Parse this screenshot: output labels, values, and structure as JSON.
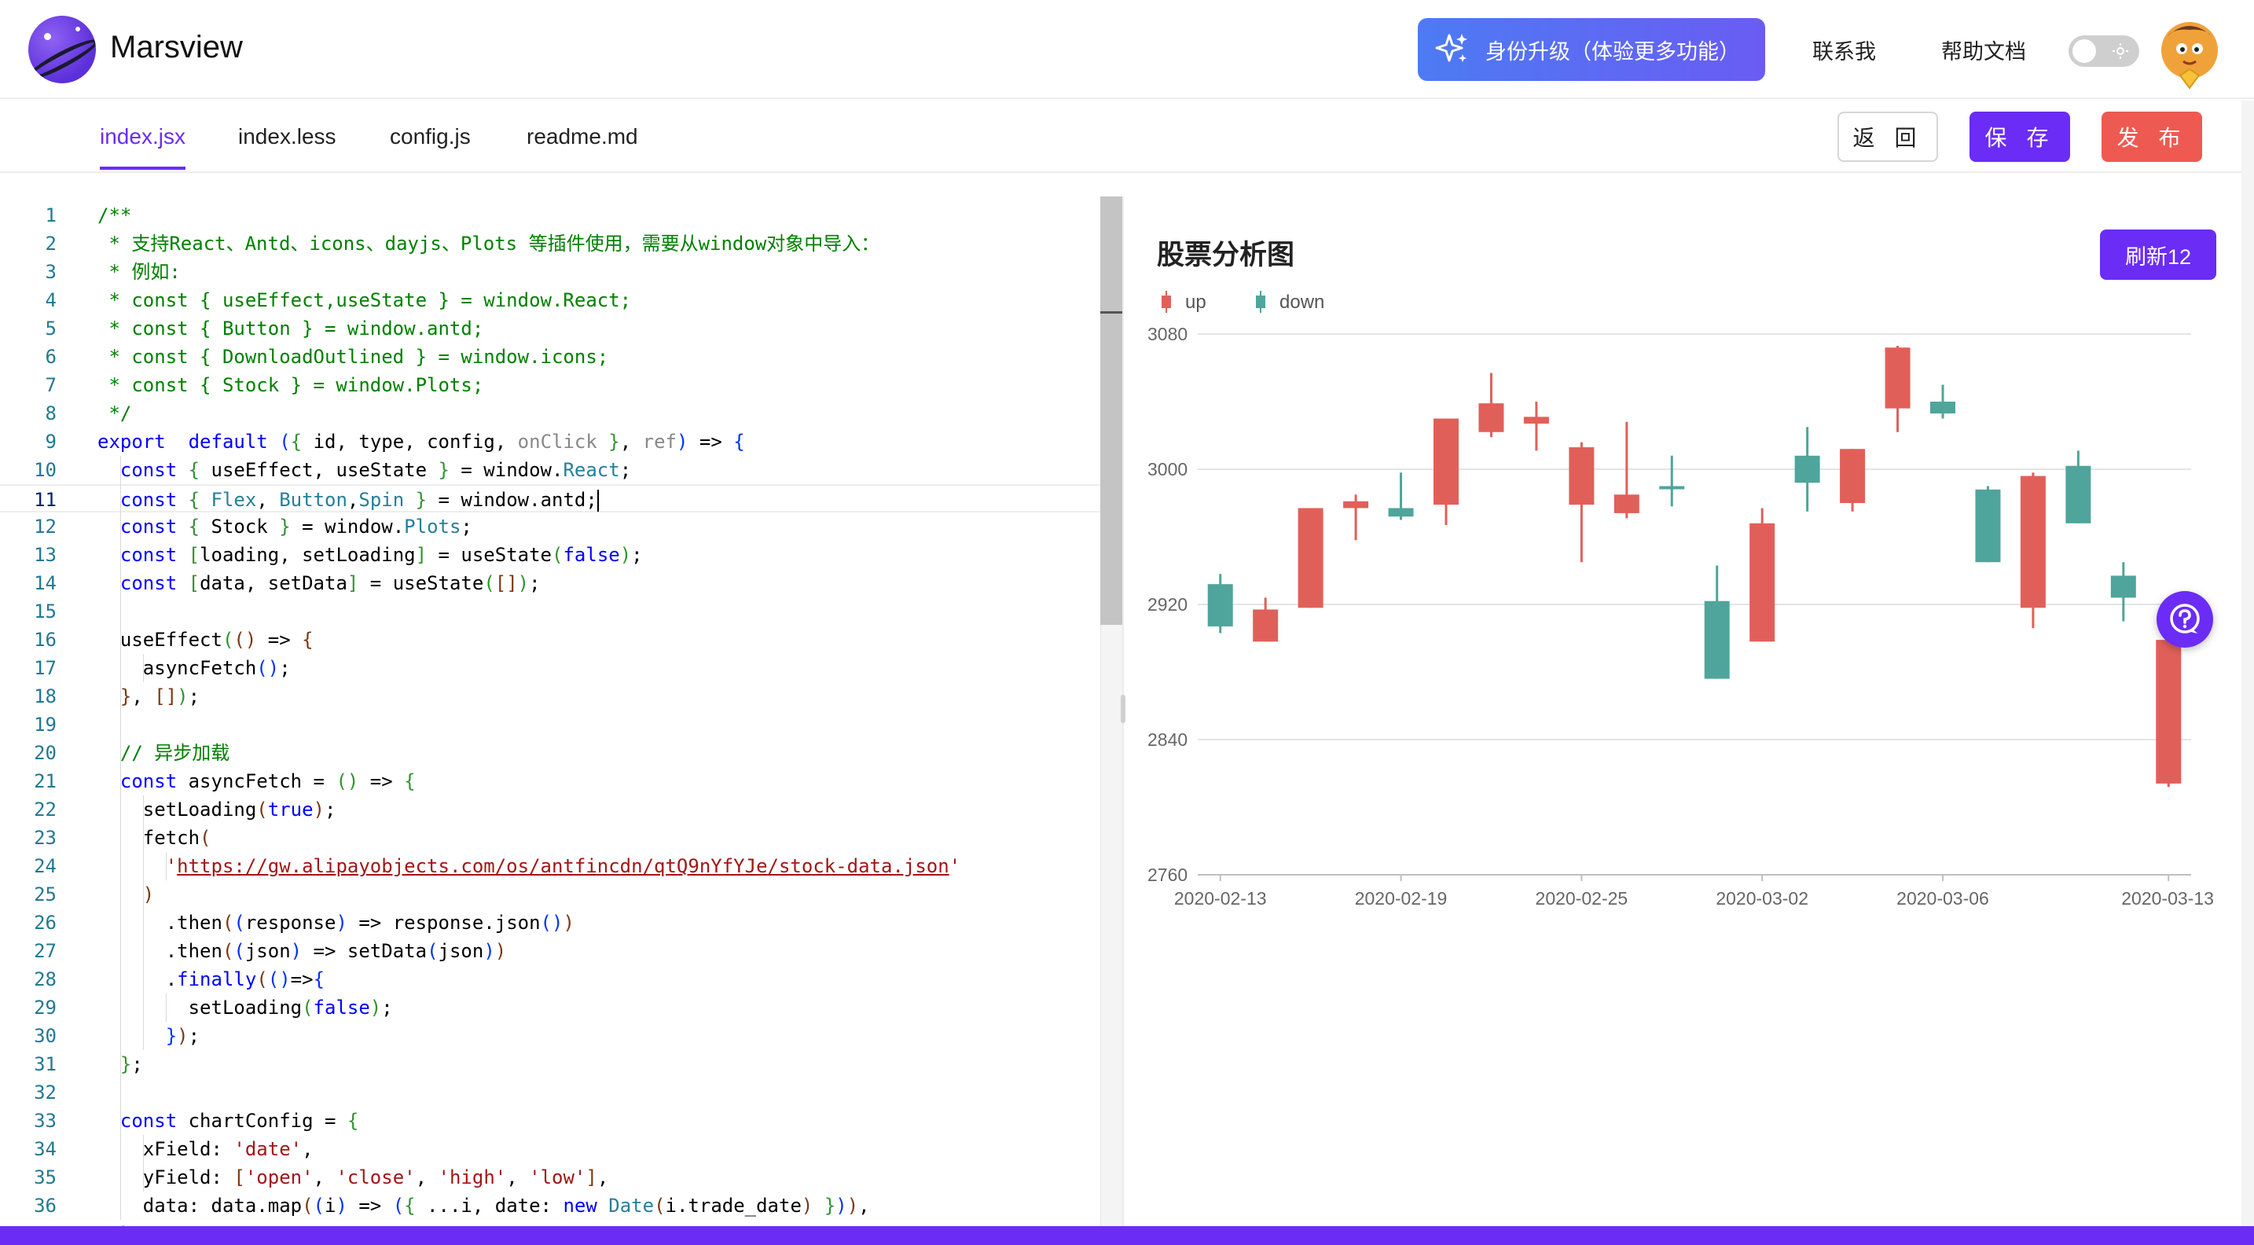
{
  "app": {
    "name": "Marsview"
  },
  "header": {
    "upgrade_label": "身份升级（体验更多功能）",
    "contact_label": "联系我",
    "help_label": "帮助文档",
    "theme_toggle_on": false
  },
  "tabs": [
    {
      "label": "index.jsx",
      "active": true
    },
    {
      "label": "index.less",
      "active": false
    },
    {
      "label": "config.js",
      "active": false
    },
    {
      "label": "readme.md",
      "active": false
    }
  ],
  "toolbar": {
    "back_label": "返 回",
    "save_label": "保 存",
    "publish_label": "发 布"
  },
  "editor": {
    "current_line": 11,
    "lines": [
      [
        [
          "cm",
          "/**"
        ]
      ],
      [
        [
          "cm",
          " * 支持React、Antd、icons、dayjs、Plots 等插件使用，需要从window对象中导入："
        ]
      ],
      [
        [
          "cm",
          " * 例如:"
        ]
      ],
      [
        [
          "cm",
          " * const { useEffect,useState } = window.React;"
        ]
      ],
      [
        [
          "cm",
          " * const { Button } = window.antd;"
        ]
      ],
      [
        [
          "cm",
          " * const { DownloadOutlined } = window.icons;"
        ]
      ],
      [
        [
          "cm",
          " * const { Stock } = window.Plots;"
        ]
      ],
      [
        [
          "cm",
          " */"
        ]
      ],
      [
        [
          "kw",
          "export"
        ],
        [
          "",
          "  "
        ],
        [
          "kw",
          "default"
        ],
        [
          "",
          " "
        ],
        [
          "br1",
          "("
        ],
        [
          "br2",
          "{"
        ],
        [
          "",
          " id, type, config, "
        ],
        [
          "gy",
          "onClick"
        ],
        [
          "",
          " "
        ],
        [
          "br2",
          "}"
        ],
        [
          "",
          ", "
        ],
        [
          "gy",
          "ref"
        ],
        [
          "br1",
          ")"
        ],
        [
          "",
          " => "
        ],
        [
          "br1",
          "{"
        ]
      ],
      [
        [
          "",
          "  "
        ],
        [
          "kw",
          "const"
        ],
        [
          "",
          " "
        ],
        [
          "br2",
          "{"
        ],
        [
          "",
          " useEffect, useState "
        ],
        [
          "br2",
          "}"
        ],
        [
          "",
          " = window."
        ],
        [
          "ty",
          "React"
        ],
        [
          "",
          ";"
        ]
      ],
      [
        [
          "",
          "  "
        ],
        [
          "kw",
          "const"
        ],
        [
          "",
          " "
        ],
        [
          "br2",
          "{"
        ],
        [
          "",
          " "
        ],
        [
          "ty",
          "Flex"
        ],
        [
          "",
          ", "
        ],
        [
          "ty",
          "Button"
        ],
        [
          "",
          ","
        ],
        [
          "ty",
          "Spin"
        ],
        [
          "",
          " "
        ],
        [
          "br2",
          "}"
        ],
        [
          "",
          " = window.antd;"
        ],
        [
          "cursor",
          ""
        ]
      ],
      [
        [
          "",
          "  "
        ],
        [
          "kw",
          "const"
        ],
        [
          "",
          " "
        ],
        [
          "br2",
          "{"
        ],
        [
          "",
          " Stock "
        ],
        [
          "br2",
          "}"
        ],
        [
          "",
          " = window."
        ],
        [
          "ty",
          "Plots"
        ],
        [
          "",
          ";"
        ]
      ],
      [
        [
          "",
          "  "
        ],
        [
          "kw",
          "const"
        ],
        [
          "",
          " "
        ],
        [
          "br2",
          "["
        ],
        [
          "",
          "loading, setLoading"
        ],
        [
          "br2",
          "]"
        ],
        [
          "",
          " = useState"
        ],
        [
          "br2",
          "("
        ],
        [
          "kw",
          "false"
        ],
        [
          "br2",
          ")"
        ],
        [
          "",
          ";"
        ]
      ],
      [
        [
          "",
          "  "
        ],
        [
          "kw",
          "const"
        ],
        [
          "",
          " "
        ],
        [
          "br2",
          "["
        ],
        [
          "",
          "data, setData"
        ],
        [
          "br2",
          "]"
        ],
        [
          "",
          " = useState"
        ],
        [
          "br2",
          "("
        ],
        [
          "br3",
          "[]"
        ],
        [
          "br2",
          ")"
        ],
        [
          "",
          ";"
        ]
      ],
      [
        [
          "",
          ""
        ]
      ],
      [
        [
          "",
          "  useEffect"
        ],
        [
          "br2",
          "("
        ],
        [
          "br3",
          "()"
        ],
        [
          "",
          " => "
        ],
        [
          "br3",
          "{"
        ]
      ],
      [
        [
          "",
          "    asyncFetch"
        ],
        [
          "br1",
          "()"
        ],
        [
          "",
          ";"
        ]
      ],
      [
        [
          "",
          "  "
        ],
        [
          "br3",
          "}"
        ],
        [
          "",
          ", "
        ],
        [
          "br3",
          "[]"
        ],
        [
          "br2",
          ")"
        ],
        [
          "",
          ";"
        ]
      ],
      [
        [
          "",
          ""
        ]
      ],
      [
        [
          "cm",
          "  // 异步加载"
        ]
      ],
      [
        [
          "",
          "  "
        ],
        [
          "kw",
          "const"
        ],
        [
          "",
          " asyncFetch = "
        ],
        [
          "br2",
          "()"
        ],
        [
          "",
          " => "
        ],
        [
          "br2",
          "{"
        ]
      ],
      [
        [
          "",
          "    setLoading"
        ],
        [
          "br3",
          "("
        ],
        [
          "kw",
          "true"
        ],
        [
          "br3",
          ")"
        ],
        [
          "",
          ";"
        ]
      ],
      [
        [
          "",
          "    fetch"
        ],
        [
          "br3",
          "("
        ]
      ],
      [
        [
          "",
          "      "
        ],
        [
          "st",
          "'"
        ],
        [
          "url",
          "https://gw.alipayobjects.com/os/antfincdn/qtQ9nYfYJe/stock-data.json"
        ],
        [
          "st",
          "'"
        ]
      ],
      [
        [
          "",
          "    "
        ],
        [
          "br3",
          ")"
        ]
      ],
      [
        [
          "",
          "      .then"
        ],
        [
          "br3",
          "("
        ],
        [
          "br1",
          "("
        ],
        [
          "",
          "response"
        ],
        [
          "br1",
          ")"
        ],
        [
          "",
          " => response.json"
        ],
        [
          "br1",
          "()"
        ],
        [
          "br3",
          ")"
        ]
      ],
      [
        [
          "",
          "      .then"
        ],
        [
          "br3",
          "("
        ],
        [
          "br1",
          "("
        ],
        [
          "",
          "json"
        ],
        [
          "br1",
          ")"
        ],
        [
          "",
          " => setData"
        ],
        [
          "br1",
          "("
        ],
        [
          "",
          "json"
        ],
        [
          "br1",
          ")"
        ],
        [
          "br3",
          ")"
        ]
      ],
      [
        [
          "",
          "      ."
        ],
        [
          "kw",
          "finally"
        ],
        [
          "br3",
          "("
        ],
        [
          "br1",
          "()"
        ],
        [
          "",
          "=>"
        ],
        [
          "br1",
          "{"
        ]
      ],
      [
        [
          "",
          "        setLoading"
        ],
        [
          "br2",
          "("
        ],
        [
          "kw",
          "false"
        ],
        [
          "br2",
          ")"
        ],
        [
          "",
          ";"
        ]
      ],
      [
        [
          "",
          "      "
        ],
        [
          "br1",
          "}"
        ],
        [
          "br3",
          ")"
        ],
        [
          "",
          ";"
        ]
      ],
      [
        [
          "",
          "  "
        ],
        [
          "br2",
          "}"
        ],
        [
          "",
          ";"
        ]
      ],
      [
        [
          "",
          ""
        ]
      ],
      [
        [
          "",
          "  "
        ],
        [
          "kw",
          "const"
        ],
        [
          "",
          " chartConfig = "
        ],
        [
          "br2",
          "{"
        ]
      ],
      [
        [
          "",
          "    xField: "
        ],
        [
          "st",
          "'date'"
        ],
        [
          "",
          ","
        ]
      ],
      [
        [
          "",
          "    yField: "
        ],
        [
          "br3",
          "["
        ],
        [
          "st",
          "'open'"
        ],
        [
          "",
          ", "
        ],
        [
          "st",
          "'close'"
        ],
        [
          "",
          ", "
        ],
        [
          "st",
          "'high'"
        ],
        [
          "",
          ", "
        ],
        [
          "st",
          "'low'"
        ],
        [
          "br3",
          "]"
        ],
        [
          "",
          ","
        ]
      ],
      [
        [
          "",
          "    data: data.map"
        ],
        [
          "br3",
          "("
        ],
        [
          "br1",
          "("
        ],
        [
          "",
          "i"
        ],
        [
          "br1",
          ")"
        ],
        [
          "",
          " => "
        ],
        [
          "br1",
          "("
        ],
        [
          "br2",
          "{"
        ],
        [
          "",
          " ...i, date: "
        ],
        [
          "kw",
          "new"
        ],
        [
          "",
          " "
        ],
        [
          "ty",
          "Date"
        ],
        [
          "br3",
          "("
        ],
        [
          "",
          "i.trade_date"
        ],
        [
          "br3",
          ")"
        ],
        [
          "",
          " "
        ],
        [
          "br2",
          "}"
        ],
        [
          "br1",
          ")"
        ],
        [
          "br3",
          ")"
        ],
        [
          "",
          ","
        ]
      ],
      [
        [
          "",
          "  "
        ],
        [
          "br2",
          "}"
        ],
        [
          "",
          ";"
        ]
      ]
    ]
  },
  "panel": {
    "title": "股票分析图",
    "refresh_label": "刷新12"
  },
  "chart_data": {
    "type": "candlestick",
    "series": [
      {
        "name": "up",
        "color": "#e06059"
      },
      {
        "name": "down",
        "color": "#4fa59b"
      }
    ],
    "y_ticks": [
      3080,
      3000,
      2920,
      2840,
      2760
    ],
    "ylim": [
      2760,
      3080
    ],
    "x_tick_labels": [
      "2020-02-13",
      "2020-02-19",
      "2020-02-25",
      "2020-03-02",
      "2020-03-06",
      "2020-03-13"
    ],
    "candles": [
      {
        "open": 2907,
        "close": 2932,
        "high": 2938,
        "low": 2903,
        "dir": "down"
      },
      {
        "open": 2917,
        "close": 2898,
        "high": 2924,
        "low": 2898,
        "dir": "up"
      },
      {
        "open": 2977,
        "close": 2918,
        "high": 2977,
        "low": 2918,
        "dir": "up"
      },
      {
        "open": 2981,
        "close": 2977,
        "high": 2985,
        "low": 2958,
        "dir": "up"
      },
      {
        "open": 2972,
        "close": 2977,
        "high": 2998,
        "low": 2970,
        "dir": "down"
      },
      {
        "open": 3030,
        "close": 2979,
        "high": 3030,
        "low": 2967,
        "dir": "up"
      },
      {
        "open": 3039,
        "close": 3022,
        "high": 3057,
        "low": 3019,
        "dir": "up"
      },
      {
        "open": 3031,
        "close": 3027,
        "high": 3040,
        "low": 3011,
        "dir": "up"
      },
      {
        "open": 3013,
        "close": 2979,
        "high": 3016,
        "low": 2945,
        "dir": "up"
      },
      {
        "open": 2985,
        "close": 2974,
        "high": 3028,
        "low": 2971,
        "dir": "up"
      },
      {
        "open": 2989,
        "close": 2990,
        "high": 3008,
        "low": 2978,
        "dir": "down"
      },
      {
        "open": 2876,
        "close": 2922,
        "high": 2943,
        "low": 2876,
        "dir": "down"
      },
      {
        "open": 2968,
        "close": 2898,
        "high": 2977,
        "low": 2898,
        "dir": "up"
      },
      {
        "open": 2992,
        "close": 3008,
        "high": 3025,
        "low": 2975,
        "dir": "down"
      },
      {
        "open": 3012,
        "close": 2980,
        "high": 3012,
        "low": 2975,
        "dir": "up"
      },
      {
        "open": 3072,
        "close": 3036,
        "high": 3073,
        "low": 3022,
        "dir": "up"
      },
      {
        "open": 3033,
        "close": 3040,
        "high": 3050,
        "low": 3030,
        "dir": "down"
      },
      {
        "open": 2945,
        "close": 2988,
        "high": 2990,
        "low": 2945,
        "dir": "down"
      },
      {
        "open": 2996,
        "close": 2918,
        "high": 2998,
        "low": 2906,
        "dir": "up"
      },
      {
        "open": 2968,
        "close": 3002,
        "high": 3011,
        "low": 2968,
        "dir": "down"
      },
      {
        "open": 2924,
        "close": 2937,
        "high": 2945,
        "low": 2910,
        "dir": "down"
      },
      {
        "open": 2899,
        "close": 2814,
        "high": 2907,
        "low": 2812,
        "dir": "up"
      }
    ]
  }
}
